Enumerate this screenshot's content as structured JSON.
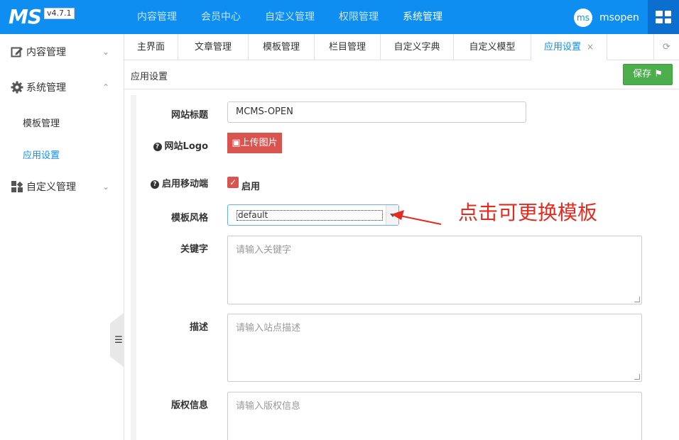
{
  "app": {
    "logo": "MS",
    "version": "v4.7.1"
  },
  "topnav": [
    {
      "label": "内容管理"
    },
    {
      "label": "会员中心"
    },
    {
      "label": "自定义管理"
    },
    {
      "label": "权限管理"
    },
    {
      "label": "系统管理"
    }
  ],
  "user": {
    "avatar_text": "ms",
    "name": "msopen"
  },
  "sidebar": {
    "groups": [
      {
        "label": "内容管理",
        "icon": "edit-icon"
      },
      {
        "label": "系统管理",
        "icon": "gear-icon"
      },
      {
        "label": "自定义管理",
        "icon": "grid-icon"
      }
    ],
    "sub_items": [
      {
        "label": "模板管理"
      },
      {
        "label": "应用设置"
      }
    ],
    "collapse_glyph": "☰"
  },
  "tabs": [
    {
      "label": "主界面"
    },
    {
      "label": "文章管理"
    },
    {
      "label": "模板管理"
    },
    {
      "label": "栏目管理"
    },
    {
      "label": "自定义字典"
    },
    {
      "label": "自定义模型"
    },
    {
      "label": "应用设置"
    }
  ],
  "page": {
    "title": "应用设置",
    "save_label": "保存"
  },
  "form": {
    "site_title_label": "网站标题",
    "site_title_value": "MCMS-OPEN",
    "logo_label": "网站Logo",
    "upload_label": "上传图片",
    "mobile_label": "启用移动端",
    "mobile_check_label": "启用",
    "template_label": "模板风格",
    "template_value": "default",
    "keywords_label": "关键字",
    "keywords_placeholder": "请输入关键字",
    "desc_label": "描述",
    "desc_placeholder": "请输入站点描述",
    "copyright_label": "版权信息",
    "copyright_placeholder": "请输入版权信息"
  },
  "annotation": {
    "text": "点击可更换模板",
    "color": "#e52b1f"
  },
  "colors": {
    "brand": "#0d8ef0",
    "save": "#4cae4c",
    "danger": "#d9534f",
    "active_link": "#0d8ef0"
  }
}
